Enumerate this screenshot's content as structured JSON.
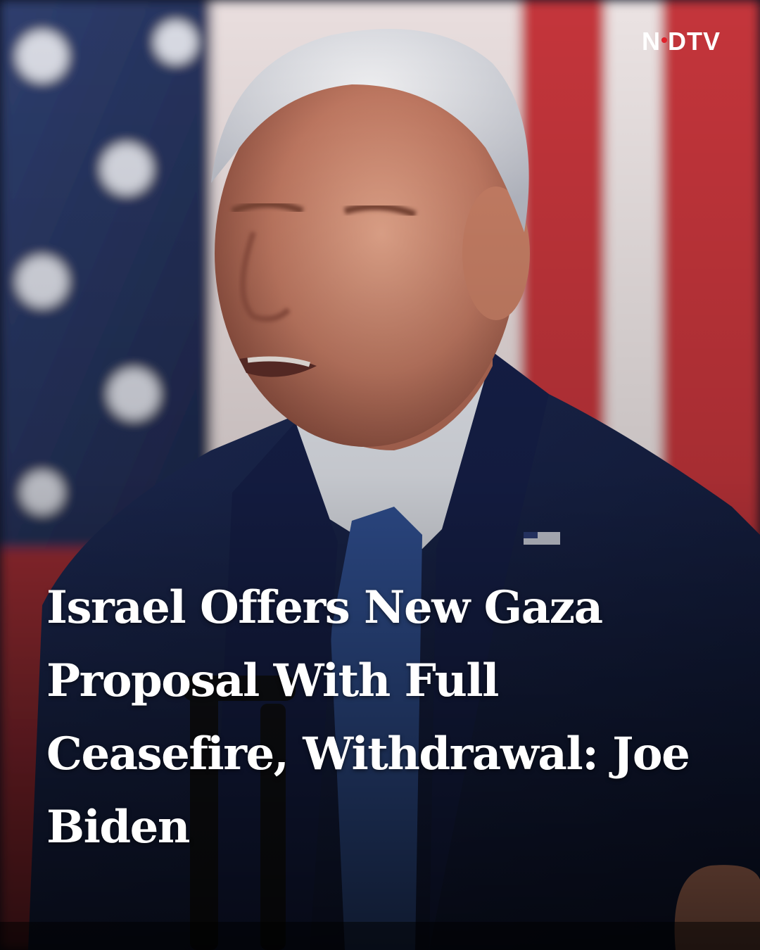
{
  "brand": {
    "part1": "N",
    "part2": "DTV",
    "accent_color": "#e0202a"
  },
  "headline": "Israel Offers New Gaza Proposal With Full Ceasefire, Withdrawal: Joe Biden",
  "photo": {
    "subject_icon": "speaker-portrait",
    "background_icon": "american-flag"
  }
}
